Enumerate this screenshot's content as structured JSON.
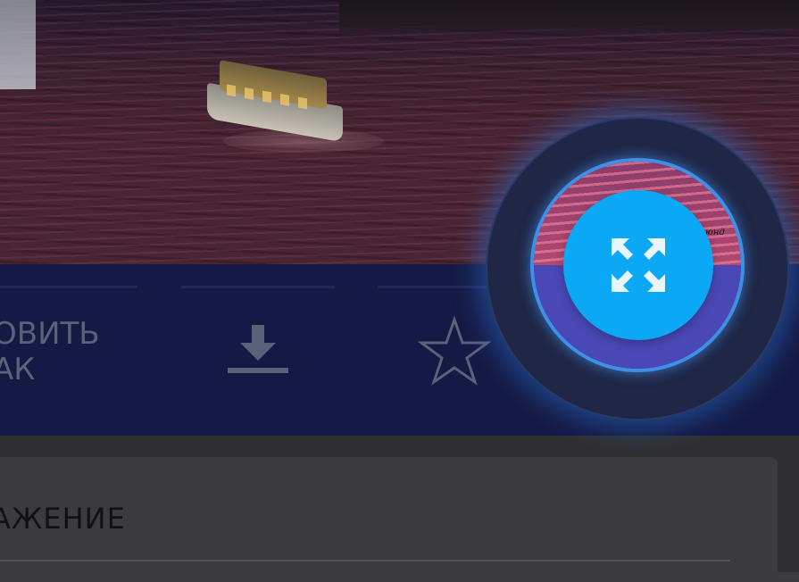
{
  "actions": {
    "share_label_line1": "ОВИТЬ",
    "share_label_line2": "АК",
    "download_icon": "download-icon",
    "favorite_icon": "star-outline-icon"
  },
  "card": {
    "title": "АЖЕНИЕ"
  },
  "fab": {
    "icon": "fullscreen-expand-icon",
    "color": "#0aa8f5"
  },
  "ring_text": "юнд"
}
